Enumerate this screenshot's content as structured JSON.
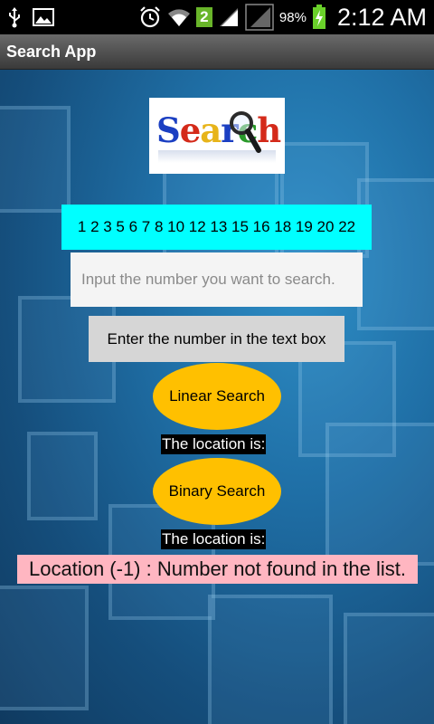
{
  "status_bar": {
    "battery_percent": "98%",
    "time": "2:12 AM",
    "sim_badge": "2",
    "icons": [
      "usb-icon",
      "image-notification-icon",
      "alarm-icon",
      "wifi-icon",
      "signal-icon",
      "signal-icon-2",
      "battery-charging-icon"
    ]
  },
  "app": {
    "title": "Search App"
  },
  "logo": {
    "letters": [
      "S",
      "e",
      "a",
      "r",
      "c",
      "h"
    ]
  },
  "numbers_list": "1 2 3 5 6 7 8 10 12 13 15 16 18 19 20 22",
  "search_input": {
    "placeholder": "Input the number you want to search.",
    "value": ""
  },
  "hint_button_label": "Enter the number in the text box",
  "linear": {
    "button_label": "Linear Search",
    "location_label": "The location is:"
  },
  "binary": {
    "button_label": "Binary Search",
    "location_label": "The location is:"
  },
  "result_text": "Location (-1) : Number not found in the list.",
  "colors": {
    "numbers_bg": "#00ffff",
    "button_oval": "#ffc000",
    "result_bg": "#ffb6c1",
    "hint_button_bg": "#d6d6d6"
  }
}
